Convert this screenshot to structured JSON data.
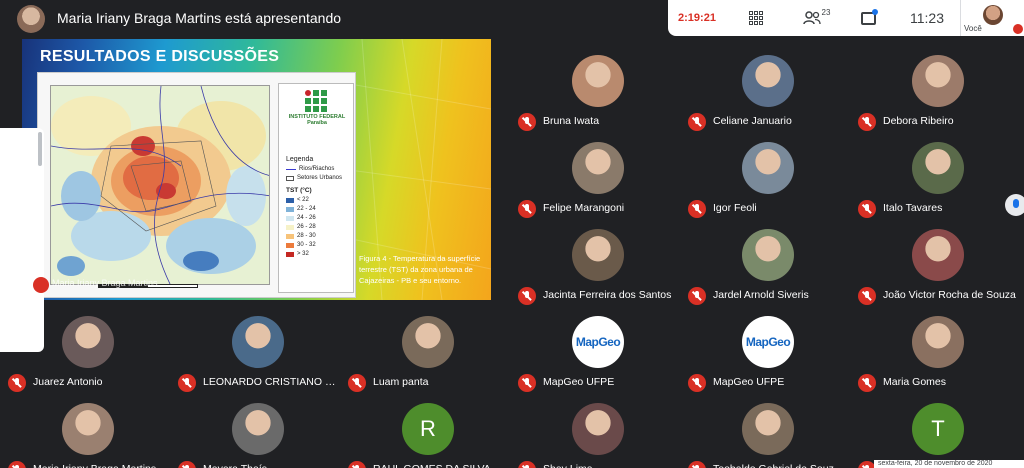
{
  "header": {
    "presenting_label": "Maria Iriany Braga Martins está apresentando"
  },
  "controls": {
    "elapsed": "2:19:21",
    "participants_count": "23",
    "clock": "11:23"
  },
  "self": {
    "label": "Você"
  },
  "slide": {
    "title": "RESULTADOS E DISCUSSÕES",
    "presenter_overlay": "Maria Iriany Braga Martins",
    "logo_text": "INSTITUTO FEDERAL\nParaíba",
    "legend_title": "Legenda",
    "legend_lines": [
      "Rios/Riachos",
      "Setores Urbanos"
    ],
    "tst_label": "TST (°C)",
    "tst_classes": [
      {
        "label": "< 22",
        "color": "#2c5fa8"
      },
      {
        "label": "22 - 24",
        "color": "#7fb2d8"
      },
      {
        "label": "24 - 26",
        "color": "#cfe6f0"
      },
      {
        "label": "26 - 28",
        "color": "#f6f2c8"
      },
      {
        "label": "28 - 30",
        "color": "#f7c37a"
      },
      {
        "label": "30 - 32",
        "color": "#ec7b3c"
      },
      {
        "label": "> 32",
        "color": "#c42823"
      }
    ],
    "caption": "Figura 4 - Temperatura da superfície terrestre (TST) da zona urbana de Cajazeiras - PB e seu entorno."
  },
  "participants": [
    {
      "name": "Bruna Iwata",
      "type": "photo",
      "color": "#b98a6e"
    },
    {
      "name": "Celiane Januario",
      "type": "photo",
      "color": "#5b6f8a"
    },
    {
      "name": "Debora Ribeiro",
      "type": "photo",
      "color": "#9c7b6a"
    },
    {
      "name": "Felipe Marangoni",
      "type": "photo",
      "color": "#8a7a6a"
    },
    {
      "name": "Igor Feoli",
      "type": "photo",
      "color": "#7a8a9a"
    },
    {
      "name": "Italo Tavares",
      "type": "photo",
      "color": "#5a6a4a"
    },
    {
      "name": "Jacinta Ferreira dos Santos",
      "type": "photo",
      "color": "#6a5a4a"
    },
    {
      "name": "Jardel Arnold Siveris",
      "type": "photo",
      "color": "#7a8a6a"
    },
    {
      "name": "João Victor Rocha de Souza",
      "type": "photo",
      "color": "#8a4a4a"
    },
    {
      "name": "Juarez Antonio",
      "type": "photo",
      "color": "#6a5a5a"
    },
    {
      "name": "LEONARDO CRISTIANO D...",
      "type": "photo",
      "color": "#4a6a8a"
    },
    {
      "name": "Luam panta",
      "type": "photo",
      "color": "#7a6a5a"
    },
    {
      "name": "MapGeo UFPE",
      "type": "logo",
      "logo": "MapGeo"
    },
    {
      "name": "MapGeo UFPE",
      "type": "logo",
      "logo": "MapGeo"
    },
    {
      "name": "Maria Gomes",
      "type": "photo",
      "color": "#8a7060"
    },
    {
      "name": "Maria Iriany Braga Martins",
      "type": "photo",
      "color": "#9a8070"
    },
    {
      "name": "Mayara Thaís",
      "type": "photo",
      "color": "#6a6a6a"
    },
    {
      "name": "RAUL GOMES DA SILVA",
      "type": "letter",
      "letter": "R",
      "color": "#4e8d2c"
    },
    {
      "name": "Shay Lima",
      "type": "photo",
      "color": "#6a4a4a"
    },
    {
      "name": "Teobaldo Gabriel de Souza...",
      "type": "photo",
      "color": "#7a6a5a"
    },
    {
      "name": "Tiago da Costa Silva",
      "type": "letter",
      "letter": "T",
      "color": "#4e8d2c"
    }
  ],
  "date_chip": "sexta-feira, 20 de novembro de 2020"
}
